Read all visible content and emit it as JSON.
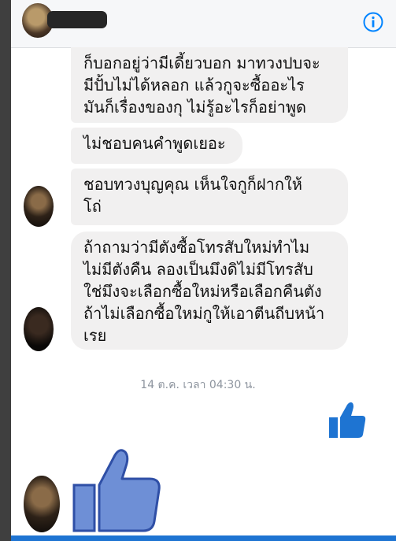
{
  "header": {
    "contact_name": "",
    "info_icon": "info-icon"
  },
  "messages": [
    {
      "sender": "other",
      "lines": [
        "ก็บอกอยู่ว่ามีเดี้ยวบอก มาทวงปบจะ",
        "มีปั้บไม่ได้หลอก แล้วกูจะซื้ออะไร",
        "มันก็เรื่องของกุ ไม่รู้อะไรก็อย่าพูด"
      ]
    },
    {
      "sender": "other",
      "lines": [
        "ไม่ชอบคนคำพูดเยอะ"
      ]
    },
    {
      "sender": "other",
      "lines": [
        "ชอบทวงบุญคุณ เห็นใจกูก็ฝากให้",
        "โถ่"
      ]
    },
    {
      "sender": "other",
      "lines": [
        "ถ้าถามว่ามีตังซื้อโทรสับใหม่ทำไม",
        "ไม่มีตังคืน ลองเป็นมึงดิไม่มีโทรสับ",
        "ใช่มึงจะเลือกซื้อใหม่หรือเลือกคืนตัง",
        "ถ้าไม่เลือกซื้อใหม่กูให้เอาตีนถีบหน้า",
        "เรย"
      ]
    }
  ],
  "timestamp": "14 ต.ค. เวลา 04:30 น.",
  "colors": {
    "messenger_blue": "#0084ff",
    "like_blue": "#1e74d2",
    "bubble_gray": "#f1f0f0",
    "timestamp_gray": "#8d949e"
  }
}
